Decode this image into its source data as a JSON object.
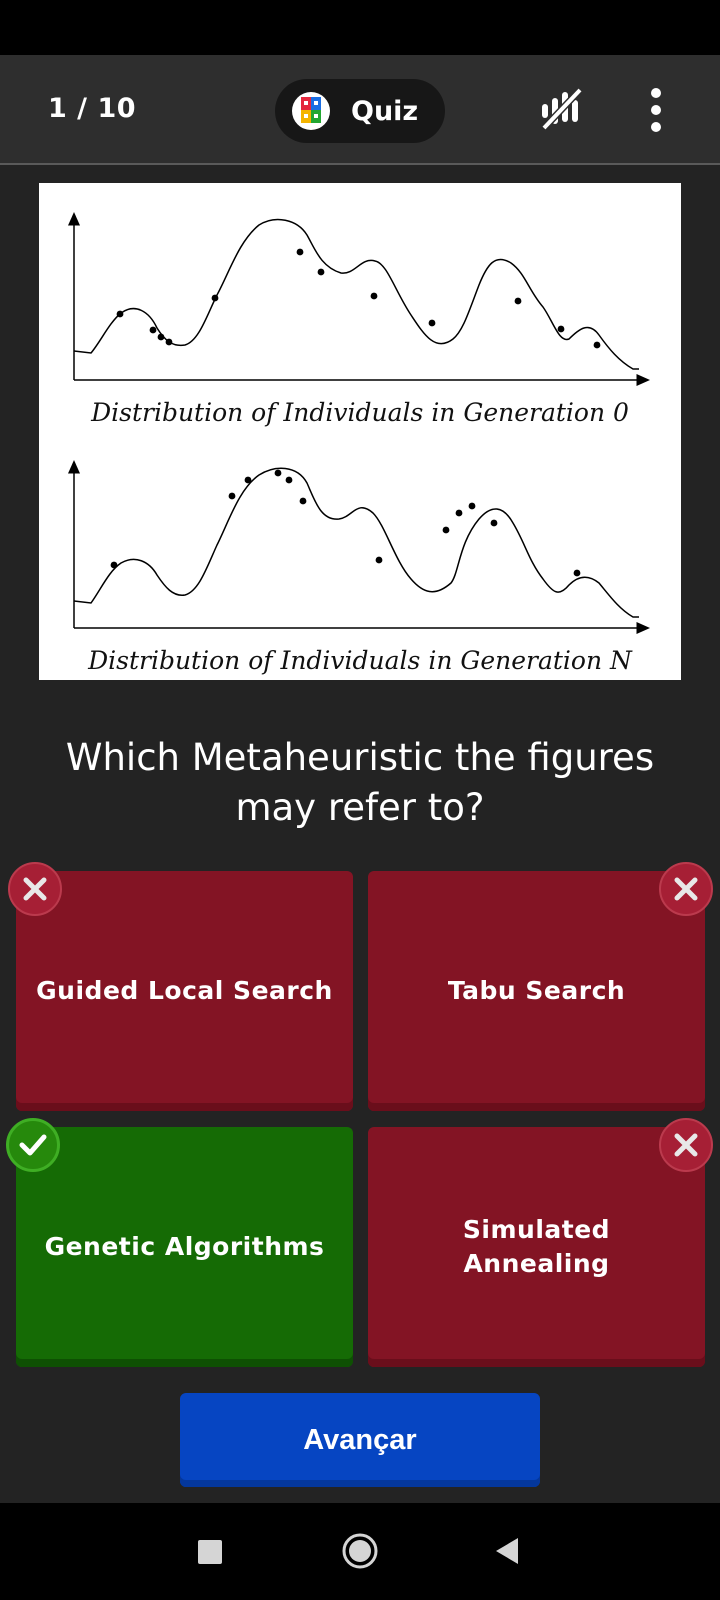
{
  "header": {
    "progress": "1 / 10",
    "title": "Quiz"
  },
  "figure": {
    "caption_top": "Distribution of Individuals in Generation 0",
    "caption_bottom": "Distribution of Individuals in Generation N"
  },
  "question": "Which Metaheuristic the figures may refer to?",
  "answers": [
    {
      "label": "Guided Local Search",
      "status": "wrong",
      "color": "#831424"
    },
    {
      "label": "Tabu Search",
      "status": "wrong",
      "color": "#831424"
    },
    {
      "label": "Genetic Algorithms",
      "status": "correct",
      "color": "#156b05"
    },
    {
      "label": "Simulated Annealing",
      "status": "wrong",
      "color": "#831424"
    }
  ],
  "next_button": {
    "label": "Avançar",
    "color": "#0645c2"
  },
  "icons": {
    "quiz_logo": "quiz-logo-icon",
    "sound": "sound-off-icon",
    "menu": "more-vertical-icon",
    "wrong_mark": "close-icon",
    "correct_mark": "checkmark-icon"
  }
}
